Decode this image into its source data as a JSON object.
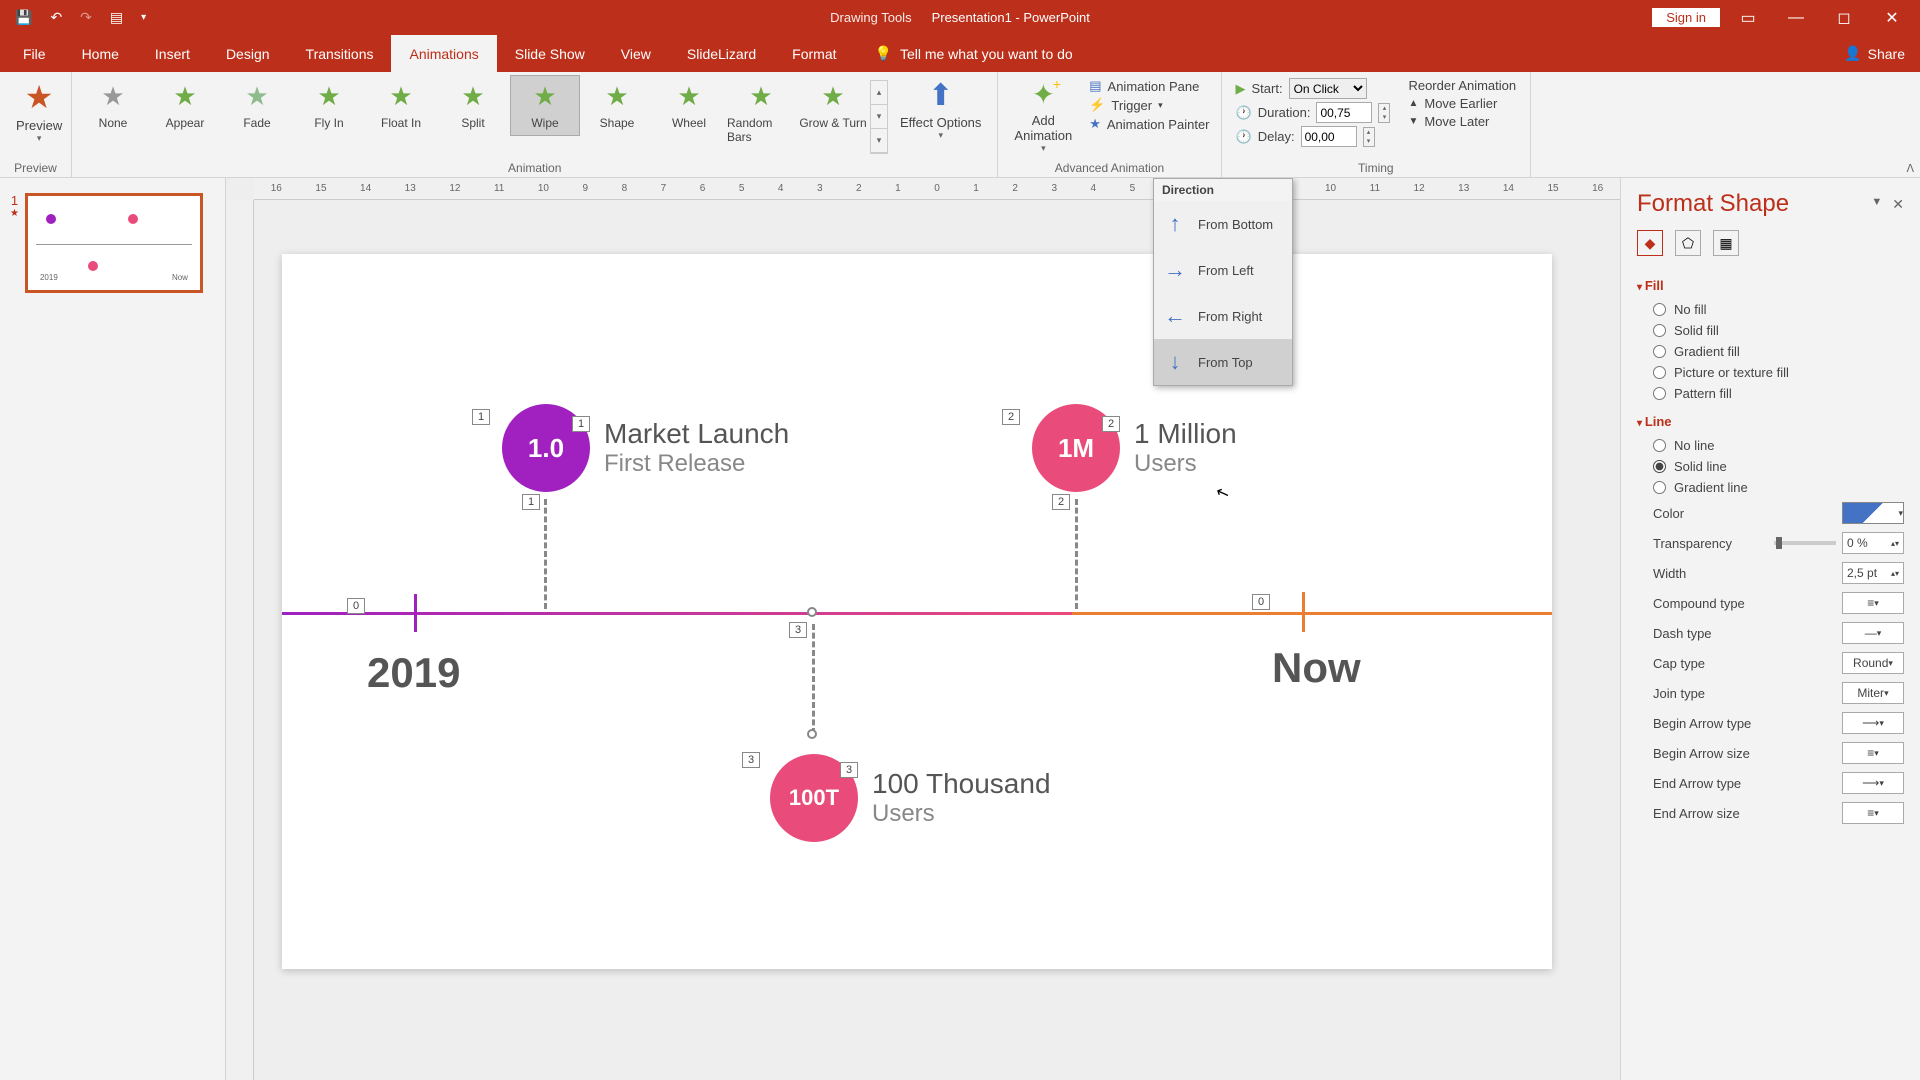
{
  "titlebar": {
    "drawingTools": "Drawing Tools",
    "docName": "Presentation1 - PowerPoint",
    "signIn": "Sign in"
  },
  "tabs": {
    "file": "File",
    "home": "Home",
    "insert": "Insert",
    "design": "Design",
    "transitions": "Transitions",
    "animations": "Animations",
    "slideshow": "Slide Show",
    "view": "View",
    "slidelizard": "SlideLizard",
    "format": "Format",
    "tellme": "Tell me what you want to do",
    "share": "Share"
  },
  "ribbon": {
    "preview": "Preview",
    "previewGroup": "Preview",
    "anims": {
      "none": "None",
      "appear": "Appear",
      "fade": "Fade",
      "flyIn": "Fly In",
      "floatIn": "Float In",
      "split": "Split",
      "wipe": "Wipe",
      "shape": "Shape",
      "wheel": "Wheel",
      "randomBars": "Random Bars",
      "growTurn": "Grow & Turn"
    },
    "animationGroup": "Animation",
    "effectOptions": "Effect Options",
    "addAnimation": "Add Animation",
    "animationPane": "Animation Pane",
    "trigger": "Trigger",
    "animationPainter": "Animation Painter",
    "advancedGroup": "Advanced Animation",
    "start": "Start:",
    "startVal": "On Click",
    "duration": "Duration:",
    "durationVal": "00,75",
    "delay": "Delay:",
    "delayVal": "00,00",
    "timingGroup": "Timing",
    "reorder": "Reorder Animation",
    "moveEarlier": "Move Earlier",
    "moveLater": "Move Later"
  },
  "direction": {
    "header": "Direction",
    "fromBottom": "From Bottom",
    "fromLeft": "From Left",
    "fromRight": "From Right",
    "fromTop": "From Top"
  },
  "slide": {
    "milestone1": {
      "circle": "1.0",
      "title": "Market Launch",
      "sub": "First Release",
      "tag1": "1",
      "tag2": "1",
      "tag3": "1"
    },
    "milestone2": {
      "circle": "1M",
      "title": "1 Million",
      "sub": "Users",
      "tag1": "2",
      "tag2": "2",
      "tag3": "2"
    },
    "milestone3": {
      "circle": "100T",
      "title": "100 Thousand",
      "sub": "Users",
      "tag1": "3",
      "tag2": "3",
      "tag3": "3"
    },
    "year1": "2019",
    "year2": "Now",
    "zero1": "0",
    "zero2": "0"
  },
  "formatShape": {
    "title": "Format Shape",
    "fill": "Fill",
    "noFill": "No fill",
    "solidFill": "Solid fill",
    "gradientFill": "Gradient fill",
    "pictureFill": "Picture or texture fill",
    "patternFill": "Pattern fill",
    "line": "Line",
    "noLine": "No line",
    "solidLine": "Solid line",
    "gradientLine": "Gradient line",
    "color": "Color",
    "transparency": "Transparency",
    "transparencyVal": "0 %",
    "width": "Width",
    "widthVal": "2,5 pt",
    "compound": "Compound type",
    "dash": "Dash type",
    "cap": "Cap type",
    "capVal": "Round",
    "join": "Join type",
    "joinVal": "Miter",
    "beginArrowType": "Begin Arrow type",
    "beginArrowSize": "Begin Arrow size",
    "endArrowType": "End Arrow type",
    "endArrowSize": "End Arrow size"
  },
  "slideNum": "1"
}
